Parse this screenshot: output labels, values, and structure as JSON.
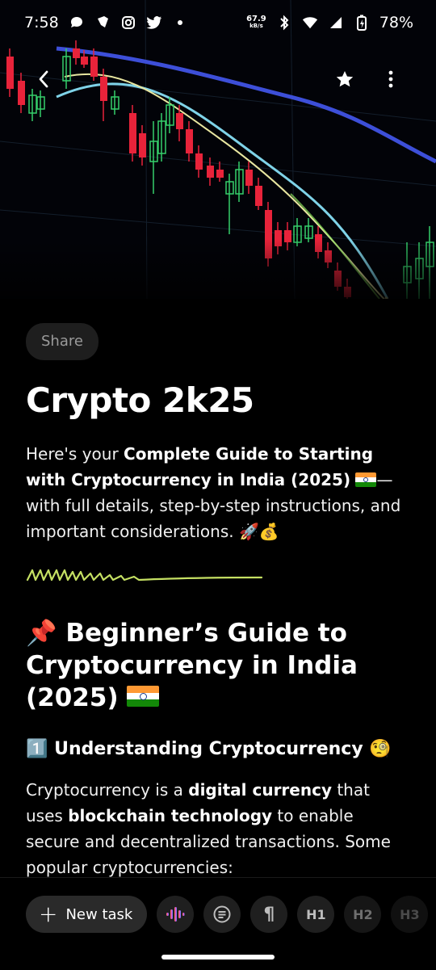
{
  "status_bar": {
    "time": "7:58",
    "net_speed_value": "67.9",
    "net_speed_unit": "kB/s",
    "battery": "78%",
    "icons": [
      "chat-icon",
      "shield-app-icon",
      "instagram-icon",
      "twitter-icon",
      "dot-icon",
      "bluetooth-icon",
      "wifi-icon",
      "signal-icon",
      "battery-icon"
    ]
  },
  "header": {
    "back_icon": "chevron-left-icon",
    "star_icon": "star-icon",
    "more_icon": "more-vert-icon"
  },
  "page": {
    "share_label": "Share",
    "title": "Crypto 2k25",
    "intro": {
      "part1": "Here's your ",
      "bold": "Complete Guide to Starting with Cryptocurrency in India (2025)",
      "part2": "—with full details, step-by-step instructions, and important considerations.",
      "emoji_tail": "🚀💰"
    },
    "heading2": {
      "emoji": "📌",
      "text": "Beginner’s Guide to Cryptocurrency in India (2025)"
    },
    "heading3": {
      "number": "1️⃣",
      "text": "Understanding Cryptocurrency",
      "emoji": "🧐"
    },
    "body": {
      "p1": "Cryptocurrency is a ",
      "b1": "digital currency",
      "p2": " that uses ",
      "b2": "blockchain technology",
      "p3": " to enable secure and decentralized transactions. Some popular cryptocurrencies:"
    }
  },
  "toolbar": {
    "new_task_label": "New task",
    "voice_icon": "voice-waveform-icon",
    "list_icon": "list-icon",
    "paragraph_label": "¶",
    "h1_label": "H1",
    "h2_label": "H2",
    "h3_label": "H3"
  },
  "colors": {
    "background": "#000000",
    "squiggle": "#c5e063",
    "candle_red": "#e8233a",
    "candle_green": "#35d06a",
    "line_blue": "#3d4fd8",
    "line_cyan": "#7fd3e8",
    "line_yellow": "#e8e6a0"
  }
}
